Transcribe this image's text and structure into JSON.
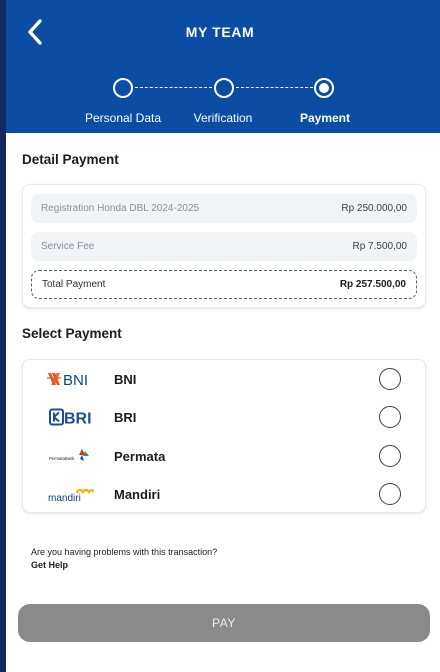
{
  "header": {
    "title": "MY TEAM",
    "back_icon": "chevron-left-icon",
    "background": "#0b4da2"
  },
  "stepper": {
    "steps": [
      {
        "label": "Personal Data",
        "active": false
      },
      {
        "label": "Verification",
        "active": false
      },
      {
        "label": "Payment",
        "active": true
      }
    ]
  },
  "detail": {
    "title": "Detail Payment",
    "rows": [
      {
        "label": "Registration Honda DBL 2024-2025",
        "value": "Rp 250.000,00"
      },
      {
        "label": "Service Fee",
        "value": "Rp 7.500,00"
      }
    ],
    "total": {
      "label": "Total Payment",
      "value": "Rp 257.500,00"
    }
  },
  "select_payment": {
    "title": "Select Payment",
    "methods": [
      {
        "name": "BNI",
        "logo": "bni-logo",
        "selected": false
      },
      {
        "name": "BRI",
        "logo": "bri-logo",
        "selected": false
      },
      {
        "name": "Permata",
        "logo": "permata-logo",
        "selected": false
      },
      {
        "name": "Mandiri",
        "logo": "mandiri-logo",
        "selected": false
      }
    ]
  },
  "help": {
    "question": "Are you having problems with this transaction?",
    "link": "Get Help"
  },
  "pay_button": {
    "label": "PAY",
    "color": "#8a8a8a"
  },
  "logo_text": {
    "bni": "BNI",
    "bri": "BRI",
    "permata": "PermataBank",
    "mandiri": "mandiri"
  }
}
